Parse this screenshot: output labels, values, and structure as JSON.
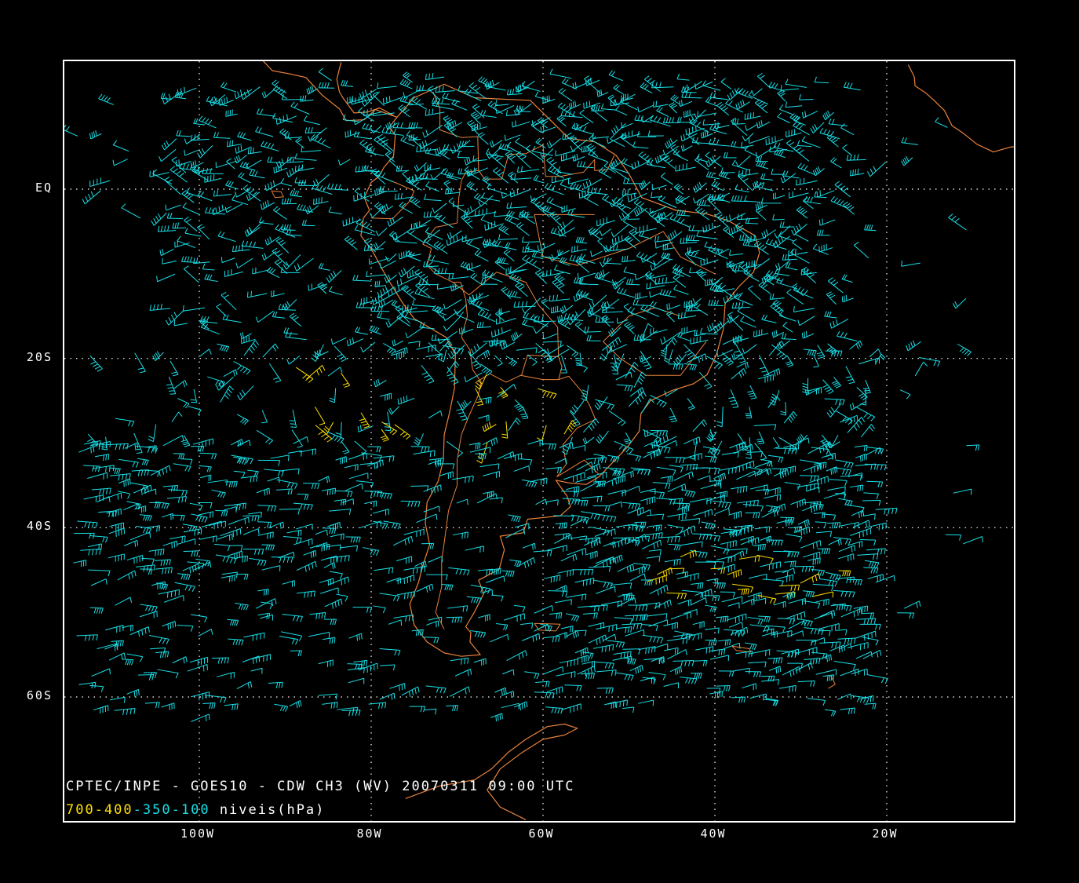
{
  "map": {
    "lat_labels": [
      {
        "text": "EQ",
        "lat": 0
      },
      {
        "text": "20S",
        "lat": -20
      },
      {
        "text": "40S",
        "lat": -40
      },
      {
        "text": "60S",
        "lat": -60
      }
    ],
    "lon_labels": [
      {
        "text": "100W",
        "lon": -100
      },
      {
        "text": "80W",
        "lon": -80
      },
      {
        "text": "60W",
        "lon": -60
      },
      {
        "text": "40W",
        "lon": -40
      },
      {
        "text": "20W",
        "lon": -20
      }
    ],
    "lon_range": [
      -115,
      5
    ],
    "lat_range": [
      -75,
      15
    ],
    "grid": "dotted",
    "colors": {
      "background": "#000000",
      "coastline": "#e8823a",
      "grid": "#ffffff",
      "wind_upper": "#18e0e8",
      "wind_lower": "#ffe000"
    }
  },
  "caption": "CPTEC/INPE - GOES10 - CDW CH3 (WV) 20070311 09:00 UTC",
  "legend": {
    "level_700_400": "700-400",
    "level_400_100": "-100",
    "separator": "-",
    "level_mid": "350",
    "units": " niveis(hPa)"
  }
}
